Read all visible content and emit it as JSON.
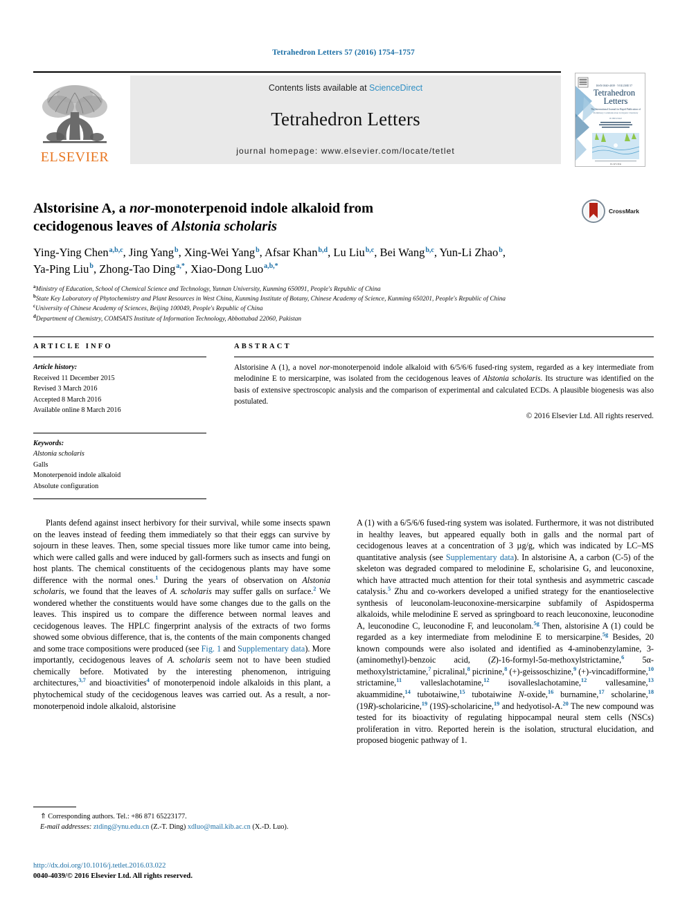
{
  "running_head": "Tetrahedron Letters 57 (2016) 1754–1757",
  "masthead": {
    "contents_prefix": "Contents lists available at ",
    "sciencedirect": "ScienceDirect",
    "journal_title": "Tetrahedron Letters",
    "homepage": "journal homepage: www.elsevier.com/locate/tetlet",
    "publisher": "ELSEVIER",
    "cover_title_line1": "Tetrahedron",
    "cover_title_line2": "Letters"
  },
  "crossmark": {
    "label": "CrossMark"
  },
  "title": {
    "line1_a": "Alstorisine A, a ",
    "line1_i": "nor",
    "line1_b": "-monoterpenoid indole alkaloid from",
    "line2_a": "cecidogenous leaves of ",
    "line2_i": "Alstonia scholaris"
  },
  "authors": [
    {
      "name": "Ying-Ying Chen",
      "sup": "a,b,c"
    },
    {
      "name": "Jing Yang",
      "sup": "b"
    },
    {
      "name": "Xing-Wei Yang",
      "sup": "b"
    },
    {
      "name": "Afsar Khan",
      "sup": "b,d"
    },
    {
      "name": "Lu Liu",
      "sup": "b,c"
    },
    {
      "name": "Bei Wang",
      "sup": "b,c"
    },
    {
      "name": "Yun-Li Zhao",
      "sup": "b"
    },
    {
      "name": "Ya-Ping Liu",
      "sup": "b"
    },
    {
      "name": "Zhong-Tao Ding",
      "sup": "a,*"
    },
    {
      "name": "Xiao-Dong Luo",
      "sup": "a,b,*"
    }
  ],
  "affiliations": [
    {
      "mark": "a",
      "text": "Ministry of Education, School of Chemical Science and Technology, Yunnan University, Kunming 650091, People's Republic of China"
    },
    {
      "mark": "b",
      "text": "State Key Laboratory of Phytochemistry and Plant Resources in West China, Kunming Institute of Botany, Chinese Academy of Science, Kunming 650201, People's Republic of China"
    },
    {
      "mark": "c",
      "text": "University of Chinese Academy of Sciences, Beijing 100049, People's Republic of China"
    },
    {
      "mark": "d",
      "text": "Department of Chemistry, COMSATS Institute of Information Technology, Abbottabad 22060, Pakistan"
    }
  ],
  "article_info": {
    "heading": "ARTICLE INFO",
    "history_label": "Article history:",
    "history": [
      "Received 11 December 2015",
      "Revised 3 March 2016",
      "Accepted 8 March 2016",
      "Available online 8 March 2016"
    ],
    "keywords_label": "Keywords:",
    "keywords": [
      "Alstonia scholaris",
      "Galls",
      "Monoterpenoid indole alkaloid",
      "Absolute configuration"
    ],
    "keyword_italic_flags": [
      true,
      false,
      false,
      false
    ]
  },
  "abstract": {
    "heading": "ABSTRACT",
    "p1_a": "Alstorisine A (1), a novel ",
    "p1_i": "nor",
    "p1_b": "-monoterpenoid indole alkaloid with 6/5/6/6 fused-ring system, regarded as a key intermediate from melodinine E to mersicarpine, was isolated from the cecidogenous leaves of ",
    "p1_i2": "Alstonia scholaris",
    "p1_c": ". Its structure was identified on the basis of extensive spectroscopic analysis and the comparison of experimental and calculated ECDs. A plausible biogenesis was also postulated.",
    "copyright": "© 2016 Elsevier Ltd. All rights reserved."
  },
  "body": {
    "left_col": {
      "s1": "Plants defend against insect herbivory for their survival, while some insects spawn on the leaves instead of feeding them immediately so that their eggs can survive by sojourn in these leaves. Then, some special tissues more like tumor came into being, which were called galls and were induced by gall-formers such as insects and fungi on host plants. The chemical constituents of the cecidogenous plants may have some difference with the normal ones.",
      "ref1": "1",
      "s2": " During the years of observation on ",
      "i1": "Alstonia scholaris",
      "s3": ", we found that the leaves of ",
      "i2": "A. scholaris",
      "s4": " may suffer galls on surface.",
      "ref2": "2",
      "s5": " We wondered whether the constituents would have some changes due to the galls on the leaves. This inspired us to compare the difference between normal leaves and cecidogenous leaves. The HPLC fingerprint analysis of the extracts of two forms showed some obvious difference, that is, the contents of the main components changed and some trace compositions were produced (see ",
      "lnk1": "Fig. 1",
      "s6": " and ",
      "lnk2": "Supplementary data",
      "s7": "). More importantly, cecidogenous leaves of ",
      "i3": "A. scholaris",
      "s8": " seem not to have been studied chemically before. Motivated by the interesting phenomenon, intriguing architectures,",
      "ref3": "3,7",
      "s9": " and bioactivities",
      "ref4": "4",
      "s10": " of monoterpenoid indole alkaloids in this plant, a phytochemical study of the cecidogenous leaves was carried out. As a result, a nor-monoterpenoid indole alkaloid, alstorisine"
    },
    "right_col": {
      "s1": "A (1) with a 6/5/6/6 fused-ring system was isolated. Furthermore, it was not distributed in healthy leaves, but appeared equally both in galls and the normal part of cecidogenous leaves at a concentration of 3 µg/g, which was indicated by LC–MS quantitative analysis (see ",
      "lnk1": "Supplementary data",
      "s2": "). In alstorisine A, a carbon (C-5) of the skeleton was degraded compared to melodinine E, scholarisine G, and leuconoxine, which have attracted much attention for their total synthesis and asymmetric cascade catalysis.",
      "ref5": "5",
      "s3": " Zhu and co-workers developed a unified strategy for the enantioselective synthesis of leuconolam-leuconoxine-mersicarpine subfamily of Aspidosperma alkaloids, while melodinine E served as springboard to reach leuconoxine, leuconodine A, leuconodine C, leuconodine F, and leuconolam.",
      "ref5g": "5g",
      "s4": " Then, alstorisine A (1) could be regarded as a key intermediate from melodinine E to mersicarpine.",
      "ref5g2": "5g",
      "s5": " Besides, 20 known compounds were also isolated and identified as 4-aminobenzylamine, 3-(aminomethyl)-benzoic acid, (",
      "zi": "Z",
      "s6": ")-16-formyl-5α-methoxylstrictamine,",
      "ref6": "6",
      "s7": " 5α-methoxylstrictamine,",
      "ref7": "7",
      "s8": " picralinal,",
      "ref8": "8",
      "s9": " picrinine,",
      "ref8b": "8",
      "s10": " (+)-geissoschizine,",
      "ref9": "9",
      "s11": " (+)-vincadifformine,",
      "ref10": "10",
      "s12": " strictamine,",
      "ref11": "11",
      "s13": " valleslachotamine,",
      "ref12": "12",
      "s14": " isovalleslachotamine,",
      "ref12b": "12",
      "s15": " vallesamine,",
      "ref13": "13",
      "s16": " akuammidine,",
      "ref14": "14",
      "s17": " tubotaiwine,",
      "ref15": "15",
      "s18": " tubotaiwine ",
      "ni": "N",
      "s19": "-oxide,",
      "ref16": "16",
      "s20": " burnamine,",
      "ref17": "17",
      "s21": " scholarine,",
      "ref18": "18",
      "s22": " (19",
      "ri": "R",
      "s23": ")-scholaricine,",
      "ref19": "19",
      "s24": " (19",
      "si": "S",
      "s25": ")-scholaricine,",
      "ref19b": "19",
      "s26": " and hedyotisol-A.",
      "ref20": "20",
      "s27": " The new compound was tested for its bioactivity of regulating hippocampal neural stem cells (NSCs) proliferation in vitro. Reported herein is the isolation, structural elucidation, and proposed biogenic pathway of 1."
    }
  },
  "footnote": {
    "corresponding": "⇑ Corresponding authors. Tel.: +86 871 65223177.",
    "email_label": "E-mail addresses:",
    "email1": "ztding@ynu.edu.cn",
    "email1_owner": "(Z.-T. Ding)",
    "email2": "xdluo@mail.kib.ac.cn",
    "email2_owner": "(X.-D. Luo)."
  },
  "imprint": {
    "doi": "http://dx.doi.org/10.1016/j.tetlet.2016.03.022",
    "issn_line": "0040-4039/© 2016 Elsevier Ltd. All rights reserved."
  },
  "colors": {
    "link_blue": "#1a6ea5",
    "sciencedirect_blue": "#2f8fc4",
    "elsevier_orange": "#E87722",
    "band_gray": "#e9e9e9"
  }
}
